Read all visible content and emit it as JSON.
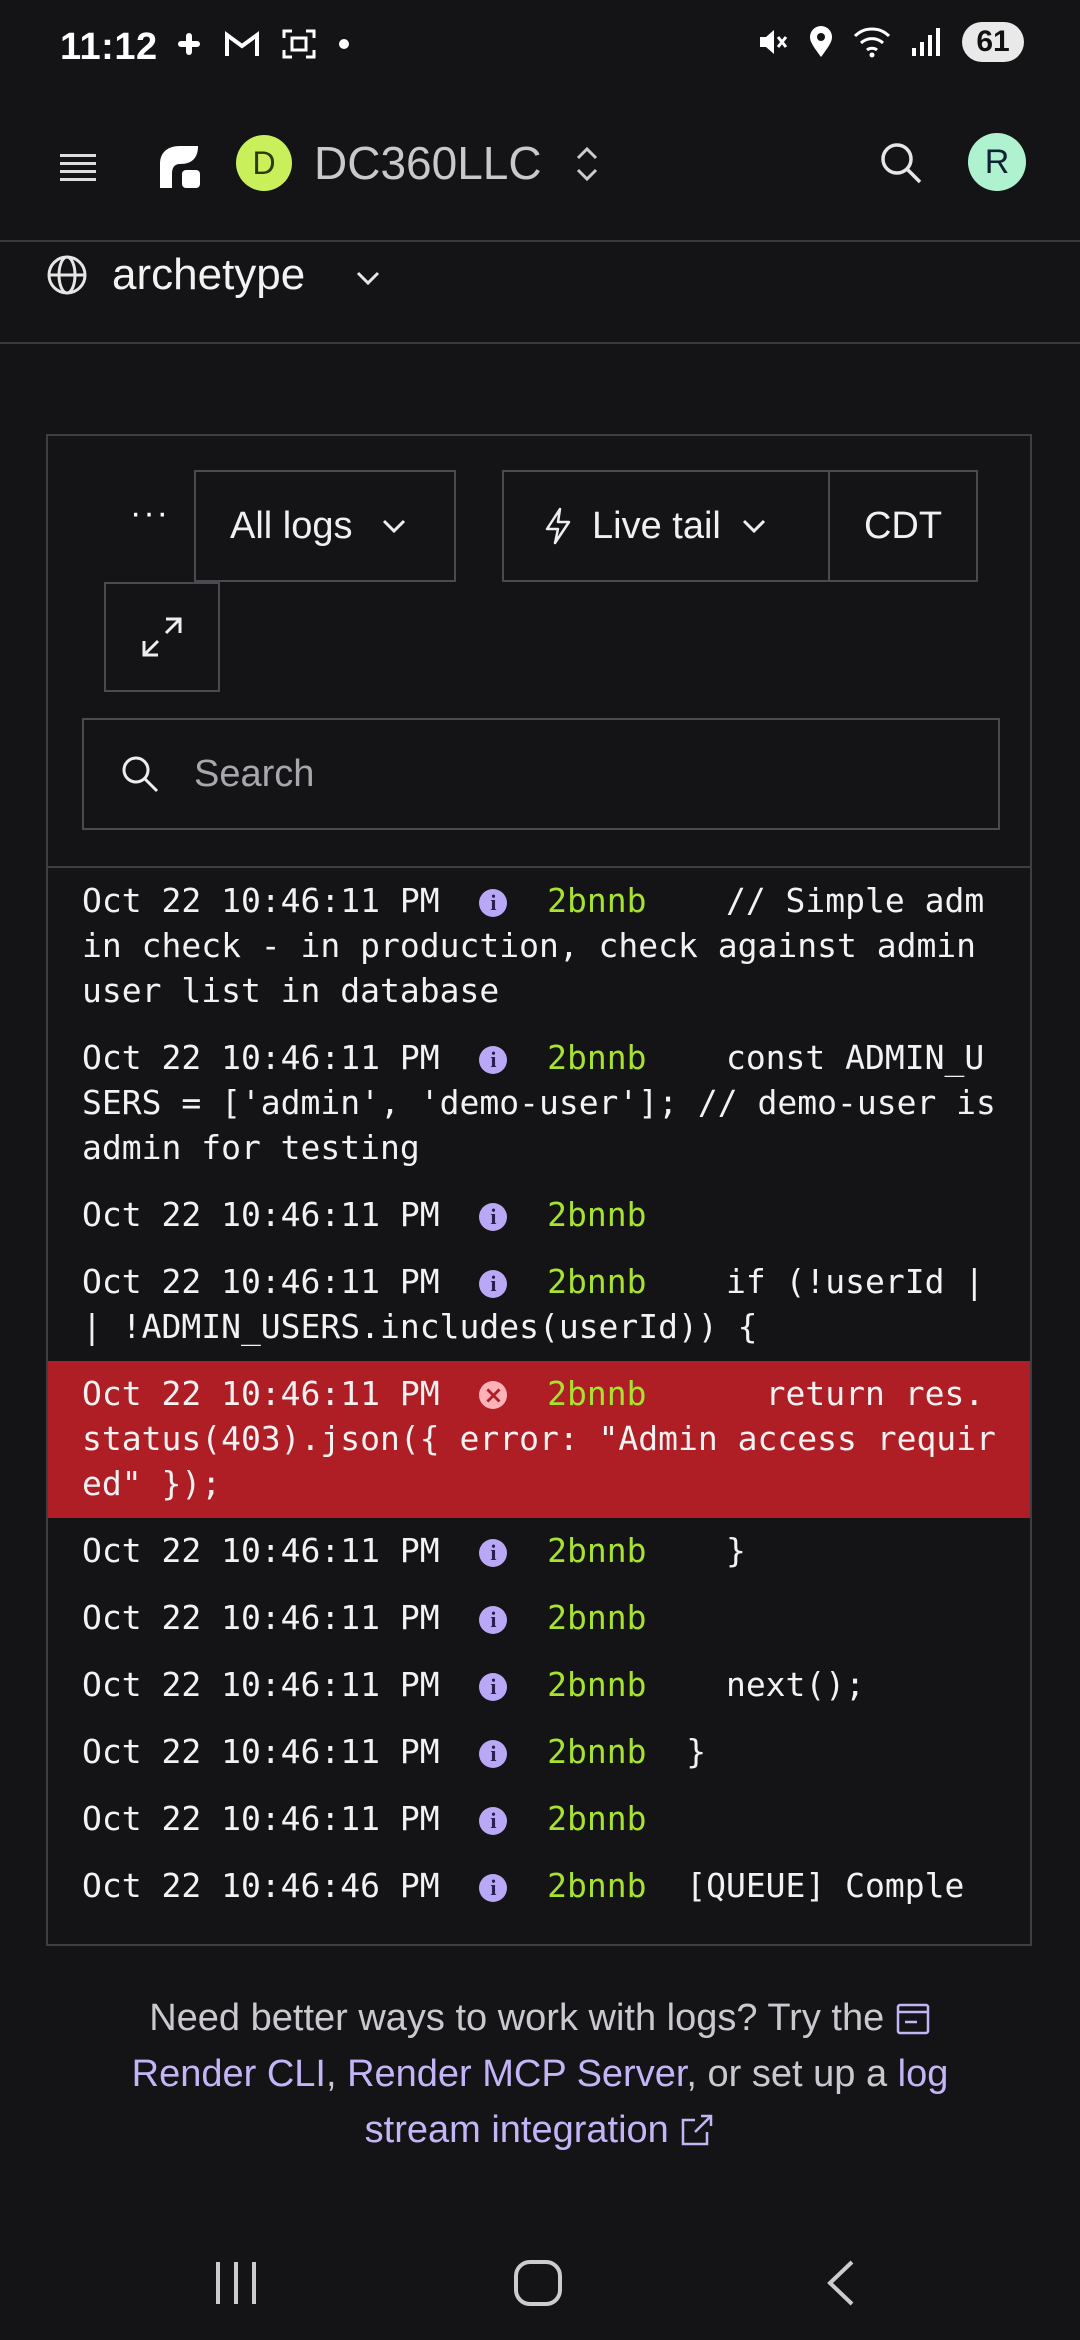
{
  "status_bar": {
    "time": "11:12",
    "battery": "61",
    "left_icons": [
      "slack-icon",
      "gmail-icon",
      "screenshot-icon",
      "dot-icon"
    ],
    "right_icons": [
      "mute-icon",
      "location-icon",
      "wifi-icon",
      "signal-icon"
    ]
  },
  "header": {
    "workspace_initial": "D",
    "workspace_name": "DC360LLC",
    "user_initial": "R",
    "workspace_avatar_color": "#c9f05a",
    "user_avatar_color": "#aef2cf"
  },
  "project": {
    "name": "archetype"
  },
  "toolbar": {
    "more_label": "···",
    "logs_filter": "All logs",
    "live_tail": "Live tail",
    "timezone": "CDT",
    "search_placeholder": "Search"
  },
  "logs": [
    {
      "time": "Oct 22 10:46:11 PM",
      "level": "info",
      "instance": "2bnnb",
      "message": "   // Simple admin check - in production, check against admin user list in database"
    },
    {
      "time": "Oct 22 10:46:11 PM",
      "level": "info",
      "instance": "2bnnb",
      "message": "   const ADMIN_USERS = ['admin', 'demo-user']; // demo-user is admin for testing"
    },
    {
      "time": "Oct 22 10:46:11 PM",
      "level": "info",
      "instance": "2bnnb",
      "message": ""
    },
    {
      "time": "Oct 22 10:46:11 PM",
      "level": "info",
      "instance": "2bnnb",
      "message": "   if (!userId || !ADMIN_USERS.includes(userId)) {"
    },
    {
      "time": "Oct 22 10:46:11 PM",
      "level": "error",
      "instance": "2bnnb",
      "message": "     return res.status(403).json({ error: \"Admin access required\" });"
    },
    {
      "time": "Oct 22 10:46:11 PM",
      "level": "info",
      "instance": "2bnnb",
      "message": "   }"
    },
    {
      "time": "Oct 22 10:46:11 PM",
      "level": "info",
      "instance": "2bnnb",
      "message": ""
    },
    {
      "time": "Oct 22 10:46:11 PM",
      "level": "info",
      "instance": "2bnnb",
      "message": "   next();"
    },
    {
      "time": "Oct 22 10:46:11 PM",
      "level": "info",
      "instance": "2bnnb",
      "message": " }"
    },
    {
      "time": "Oct 22 10:46:11 PM",
      "level": "info",
      "instance": "2bnnb",
      "message": ""
    },
    {
      "time": "Oct 22 10:46:46 PM",
      "level": "info",
      "instance": "2bnnb",
      "message": " [QUEUE] Comple"
    }
  ],
  "footer": {
    "text_before": "Need better ways to work with logs? Try the ",
    "render_cli": "Render CLI",
    "comma": ", ",
    "mcp": "Render MCP Server",
    "text_mid": ", or set up a ",
    "integration": "log stream integration"
  },
  "colors": {
    "background": "#141417",
    "error_row": "#b01e25",
    "instance": "#a6e22e",
    "link": "#c4b5f7"
  }
}
